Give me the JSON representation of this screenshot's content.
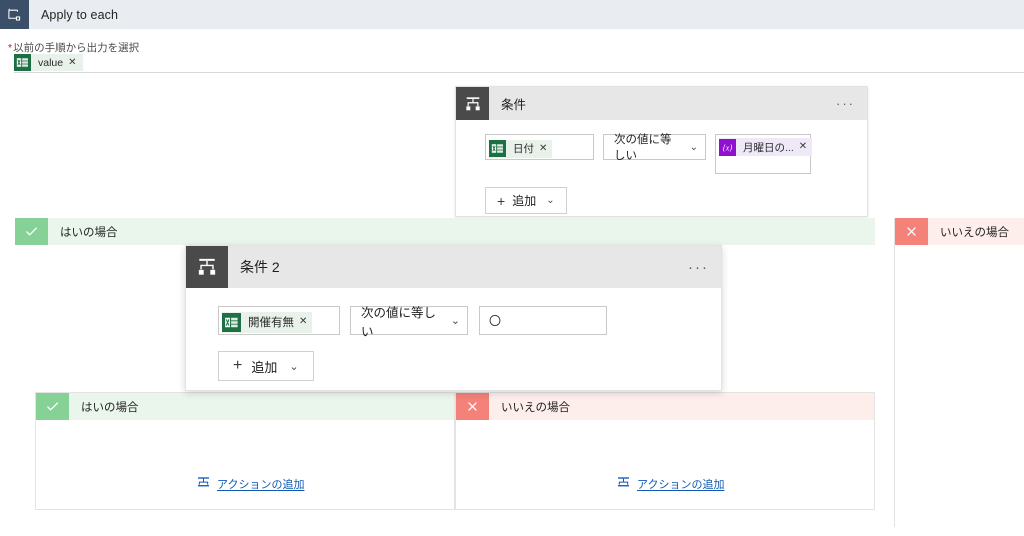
{
  "appbar": {
    "title": "Apply to each",
    "icon": "apply-to-each-icon"
  },
  "input_field": {
    "required_marker": "*",
    "label": "以前の手順から出力を選択",
    "token": {
      "text": "value",
      "icon": "excel-icon",
      "remove": "✕"
    }
  },
  "condition1": {
    "title": "条件",
    "icon": "condition-icon",
    "menu": "···",
    "left_operand": {
      "text": "日付",
      "icon": "excel-icon",
      "remove": "✕"
    },
    "operator": {
      "value": "次の値に等しい",
      "chevron": "⌄"
    },
    "right_operand": {
      "text": "月曜日の...",
      "icon": "expression-icon",
      "icon_glyph": "{x}",
      "remove": "✕"
    },
    "add_button": {
      "plus": "+",
      "label": "追加",
      "chevron": "⌄"
    }
  },
  "condition2": {
    "title": "条件 2",
    "icon": "condition-icon",
    "menu": "···",
    "left_operand": {
      "text": "開催有無",
      "icon": "excel-icon",
      "remove": "✕"
    },
    "operator": {
      "value": "次の値に等しい",
      "chevron": "⌄"
    },
    "right_value": "〇",
    "add_button": {
      "plus": "+",
      "label": "追加",
      "chevron": "⌄"
    }
  },
  "outer_branches": {
    "yes": {
      "label": "はいの場合",
      "icon": "check-icon",
      "glyph": "✓"
    },
    "no": {
      "label": "いいえの場合",
      "icon": "cross-icon",
      "glyph": "✕"
    }
  },
  "inner_branches": {
    "yes": {
      "label": "はいの場合",
      "icon": "check-icon",
      "glyph": "✓",
      "add_action": {
        "label": "アクションの追加",
        "icon": "add-action-icon"
      }
    },
    "no": {
      "label": "いいえの場合",
      "icon": "cross-icon",
      "glyph": "✕",
      "add_action": {
        "label": "アクションの追加",
        "icon": "add-action-icon"
      }
    }
  },
  "colors": {
    "appbar_bg": "#e9edf2",
    "appbar_icon": "#3b5068",
    "card_head_bg": "#e7e7e7",
    "card_icon": "#4a4a4a",
    "yes_icon": "#86d195",
    "yes_bg": "#eaf6ec",
    "no_icon": "#f4817a",
    "no_bg": "#fdeeec",
    "excel_green": "#1d7044",
    "expression_purple": "#9010d0",
    "link_blue": "#0f58b5",
    "required_red": "#a4262c"
  }
}
